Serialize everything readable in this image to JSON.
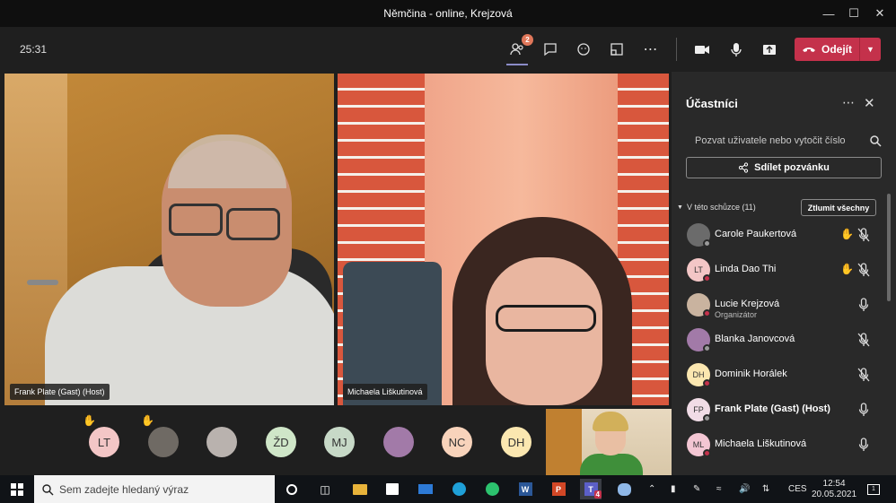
{
  "window": {
    "title": "Němčina - online, Krejzová"
  },
  "toolbar": {
    "timer": "25:31",
    "participants_badge": "2",
    "leave_label": "Odejít"
  },
  "videos": [
    {
      "label": "Frank Plate (Gast) (Host)"
    },
    {
      "label": "Michaela Liškutinová"
    }
  ],
  "gallery": {
    "avatars": [
      {
        "initials": "LT",
        "bg": "#f3c6c6"
      },
      {
        "initials": "",
        "bg": "#6f6a64"
      },
      {
        "initials": "",
        "bg": "#b9b2ae"
      },
      {
        "initials": "ŽD",
        "bg": "#cfe6c8"
      },
      {
        "initials": "MJ",
        "bg": "#c7d9c7"
      },
      {
        "initials": "",
        "bg": "#a27aa8"
      },
      {
        "initials": "NC",
        "bg": "#f8d3bb"
      },
      {
        "initials": "DH",
        "bg": "#fbe7b0"
      }
    ]
  },
  "panel": {
    "title": "Účastníci",
    "search_placeholder": "Pozvat uživatele nebo vytočit číslo",
    "share_label": "Sdílet pozvánku",
    "section_label": "V této schůzce (11)",
    "mute_all_label": "Ztlumit všechny",
    "participants": [
      {
        "name": "Carole Paukertová",
        "initials": "",
        "bg": "#6b6b6b",
        "status": "#9a9a9a",
        "hand": true,
        "muted": true,
        "sub": "",
        "bold": false
      },
      {
        "name": "Linda Dao Thi",
        "initials": "LT",
        "bg": "#f3c6c6",
        "status": "#c4314b",
        "hand": true,
        "muted": true,
        "sub": "",
        "bold": false
      },
      {
        "name": "Lucie Krejzová",
        "initials": "",
        "bg": "#c9b39f",
        "status": "#c4314b",
        "hand": false,
        "muted": false,
        "sub": "Organizátor",
        "bold": false
      },
      {
        "name": "Blanka Janovcová",
        "initials": "",
        "bg": "#a27aa8",
        "status": "#9a9a9a",
        "hand": false,
        "muted": true,
        "sub": "",
        "bold": false
      },
      {
        "name": "Dominik Horálek",
        "initials": "DH",
        "bg": "#fbe7b0",
        "status": "#c4314b",
        "hand": false,
        "muted": true,
        "sub": "",
        "bold": false
      },
      {
        "name": "Frank Plate (Gast) (Host)",
        "initials": "FP",
        "bg": "#f1dce6",
        "status": "#9a9a9a",
        "hand": false,
        "muted": false,
        "sub": "",
        "bold": true
      },
      {
        "name": "Michaela Liškutinová",
        "initials": "ML",
        "bg": "#f3c6d3",
        "status": "#c4314b",
        "hand": false,
        "muted": false,
        "sub": "",
        "bold": false
      }
    ]
  },
  "taskbar": {
    "search_placeholder": "Sem zadejte hledaný výraz",
    "teams_badge": "4",
    "language": "CES",
    "time": "12:54",
    "date": "20.05.2021",
    "notifications": "1"
  },
  "colors": {
    "accent_red": "#c4314b",
    "panel_bg": "#292929",
    "stage_bg": "#1f1f1f"
  }
}
